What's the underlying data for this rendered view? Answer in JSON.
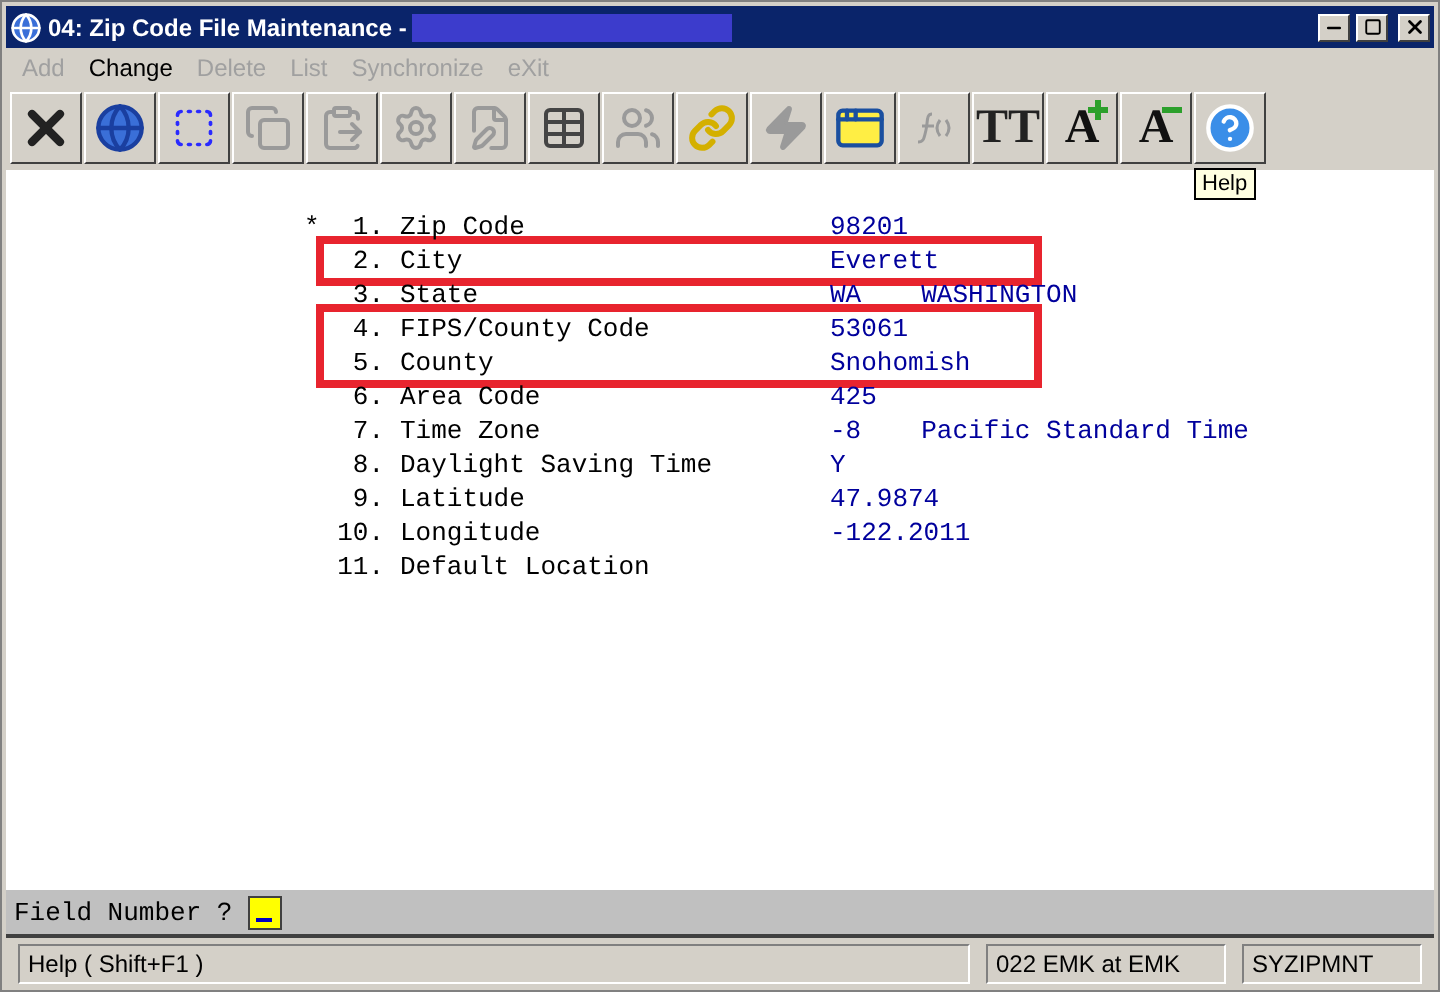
{
  "window": {
    "title": "04: Zip Code File Maintenance -"
  },
  "menu": [
    {
      "label": "Add",
      "disabled": true
    },
    {
      "label": "Change",
      "disabled": false
    },
    {
      "label": "Delete",
      "disabled": true
    },
    {
      "label": "List",
      "disabled": true
    },
    {
      "label": "Synchronize",
      "disabled": true
    },
    {
      "label": "eXit",
      "disabled": true
    }
  ],
  "toolbar": [
    {
      "kind": "close",
      "disabled": false
    },
    {
      "kind": "globe",
      "disabled": false
    },
    {
      "kind": "select",
      "disabled": false
    },
    {
      "kind": "copy",
      "disabled": true
    },
    {
      "kind": "paste",
      "disabled": true
    },
    {
      "kind": "settings",
      "disabled": true
    },
    {
      "kind": "edit",
      "disabled": true
    },
    {
      "kind": "grid",
      "disabled": false
    },
    {
      "kind": "people",
      "disabled": true
    },
    {
      "kind": "link",
      "disabled": false
    },
    {
      "kind": "bolt",
      "disabled": true
    },
    {
      "kind": "window-bolt",
      "disabled": false
    },
    {
      "kind": "function",
      "disabled": true
    },
    {
      "kind": "font",
      "glyph": "TT",
      "disabled": false
    },
    {
      "kind": "font-up",
      "glyph": "A",
      "disabled": false
    },
    {
      "kind": "font-down",
      "glyph": "A",
      "disabled": false
    },
    {
      "kind": "help",
      "disabled": false
    }
  ],
  "tooltip": "Help",
  "fields": [
    {
      "marker": "*",
      "number": "1.",
      "label": "Zip Code",
      "value": "98201",
      "highlighted": false
    },
    {
      "number": "2.",
      "label": "City",
      "value": "Everett",
      "highlighted": true
    },
    {
      "number": "3.",
      "label": "State",
      "value": "WA",
      "value_2": "WASHINGTON",
      "highlighted": false
    },
    {
      "number": "4.",
      "label": "FIPS/County Code",
      "value": "53061",
      "highlighted": true
    },
    {
      "number": "5.",
      "label": "County",
      "value": "Snohomish",
      "highlighted": true
    },
    {
      "number": "6.",
      "label": "Area Code",
      "value": "425",
      "highlighted": false
    },
    {
      "number": "7.",
      "label": "Time Zone",
      "value": "-8",
      "value_2": "Pacific Standard Time",
      "highlighted": false
    },
    {
      "number": "8.",
      "label": "Daylight Saving Time",
      "value": "Y",
      "highlighted": false
    },
    {
      "number": "9.",
      "label": "Latitude",
      "value": "47.9874",
      "highlighted": false
    },
    {
      "number": "10.",
      "label": "Longitude",
      "value": "-122.2011",
      "highlighted": false
    },
    {
      "number": "11.",
      "label": "Default Location",
      "highlighted": false
    }
  ],
  "prompt": {
    "label": "Field Number ?"
  },
  "status_bar": [
    "Help ( Shift+F1 )",
    "022 EMK at EMK",
    "SYZIPMNT"
  ]
}
